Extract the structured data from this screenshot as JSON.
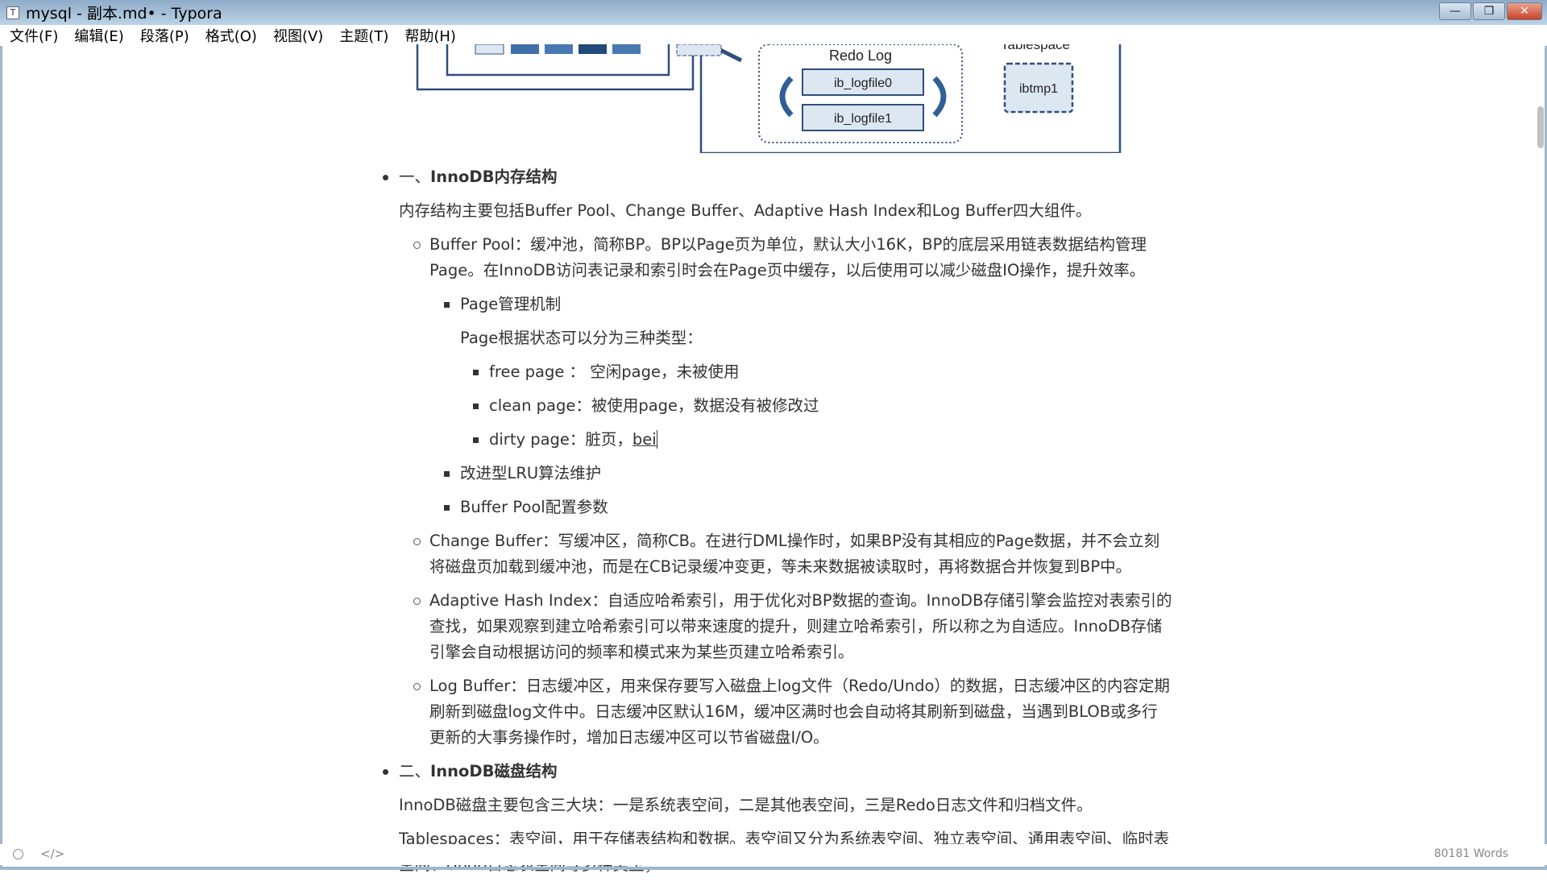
{
  "window": {
    "title": "mysql - 副本.md• - Typora",
    "app_icon": "T"
  },
  "menu": [
    "文件(F)",
    "编辑(E)",
    "段落(P)",
    "格式(O)",
    "视图(V)",
    "主题(T)",
    "帮助(H)"
  ],
  "diagram": {
    "redo_log": "Redo Log",
    "logfile0": "ib_logfile0",
    "logfile1": "ib_logfile1",
    "tablespace": "Tablespace",
    "ibtmp": "ibtmp1"
  },
  "doc": {
    "h1": {
      "num": "一、",
      "text": "InnoDB内存结构"
    },
    "p1": "内存结构主要包括Buffer Pool、Change Buffer、Adaptive Hash Index和Log Buffer四大组件。",
    "bp": "Buffer Pool：缓冲池，简称BP。BP以Page页为单位，默认大小16K，BP的底层采用链表数据结构管理Page。在InnoDB访问表记录和索引时会在Page页中缓存，以后使用可以减少磁盘IO操作，提升效率。",
    "page_mgmt": "Page管理机制",
    "page_types_intro": "Page根据状态可以分为三种类型：",
    "free_page": "free page ： 空闲page，未被使用",
    "clean_page": "clean page：被使用page，数据没有被修改过",
    "dirty_page": "dirty page：脏页，",
    "dirty_typed": "bei",
    "lru": "改进型LRU算法维护",
    "bp_config": "Buffer Pool配置参数",
    "cb": "Change Buffer：写缓冲区，简称CB。在进行DML操作时，如果BP没有其相应的Page数据，并不会立刻将磁盘页加载到缓冲池，而是在CB记录缓冲变更，等未来数据被读取时，再将数据合并恢复到BP中。",
    "ahi": "Adaptive Hash Index：自适应哈希索引，用于优化对BP数据的查询。InnoDB存储引擎会监控对表索引的查找，如果观察到建立哈希索引可以带来速度的提升，则建立哈希索引，所以称之为自适应。InnoDB存储引擎会自动根据访问的频率和模式来为某些页建立哈希索引。",
    "lb": "Log Buffer：日志缓冲区，用来保存要写入磁盘上log文件（Redo/Undo）的数据，日志缓冲区的内容定期刷新到磁盘log文件中。日志缓冲区默认16M，缓冲区满时也会自动将其刷新到磁盘，当遇到BLOB或多行更新的大事务操作时，增加日志缓冲区可以节省磁盘I/O。",
    "h2": {
      "num": "二、",
      "text": "InnoDB磁盘结构"
    },
    "p2": "InnoDB磁盘主要包含三大块：一是系统表空间，二是其他表空间，三是Redo日志文件和归档文件。",
    "p3": "Tablespaces：表空间，用于存储表结构和数据。表空间又分为系统表空间、独立表空间、通用表空间、临时表空间、Undo日志表空间等多种类型；"
  },
  "status": {
    "word_count": "80181 Words"
  }
}
